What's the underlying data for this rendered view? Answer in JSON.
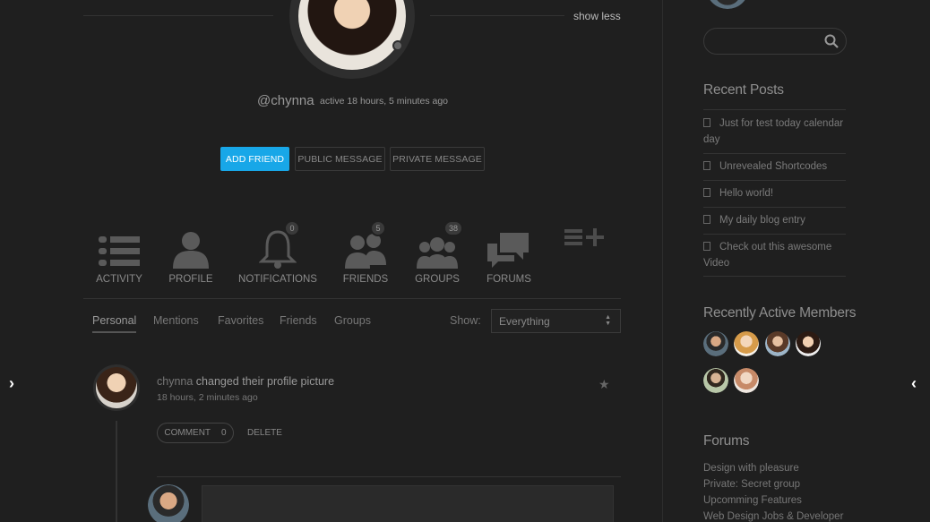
{
  "colors": {
    "background": "#1f1f1f",
    "accent": "#18a7e8",
    "text": "#8a8a8a"
  },
  "profile": {
    "username": "@chynna",
    "activity_status": "active 18 hours, 5 minutes ago",
    "show_less": "show less"
  },
  "actions": {
    "add_friend": "ADD FRIEND",
    "public_message": "PUBLIC MESSAGE",
    "private_message": "PRIVATE MESSAGE"
  },
  "nav": [
    {
      "label": "ACTIVITY",
      "icon": "list-icon"
    },
    {
      "label": "PROFILE",
      "icon": "user-icon"
    },
    {
      "label": "NOTIFICATIONS",
      "icon": "bell-icon",
      "count": "0"
    },
    {
      "label": "FRIENDS",
      "icon": "friends-icon",
      "count": "5"
    },
    {
      "label": "GROUPS",
      "icon": "groups-icon",
      "count": "38"
    },
    {
      "label": "FORUMS",
      "icon": "chat-bubbles-icon"
    },
    {
      "label": "",
      "icon": "list-add-icon"
    }
  ],
  "subtabs": [
    "Personal",
    "Mentions",
    "Favorites",
    "Friends",
    "Groups"
  ],
  "filter": {
    "label": "Show:",
    "value": "Everything"
  },
  "activity": {
    "user": "chynna",
    "action": " changed their profile picture",
    "time": "18 hours, 2 minutes ago",
    "comment_label": "COMMENT",
    "comment_count": "0",
    "delete_label": "DELETE"
  },
  "sidebar": {
    "recent_posts_title": "Recent Posts",
    "recent_posts": [
      "Just for test today calendar day",
      "Unrevealed Shortcodes",
      "Hello world!",
      "My daily blog entry",
      "Check out this awesome Video"
    ],
    "members_title": "Recently Active Members",
    "forums_title": "Forums",
    "forums": [
      "Design with pleasure",
      "Private: Secret group",
      "Upcomming Features",
      "Web Design Jobs & Developer"
    ]
  }
}
